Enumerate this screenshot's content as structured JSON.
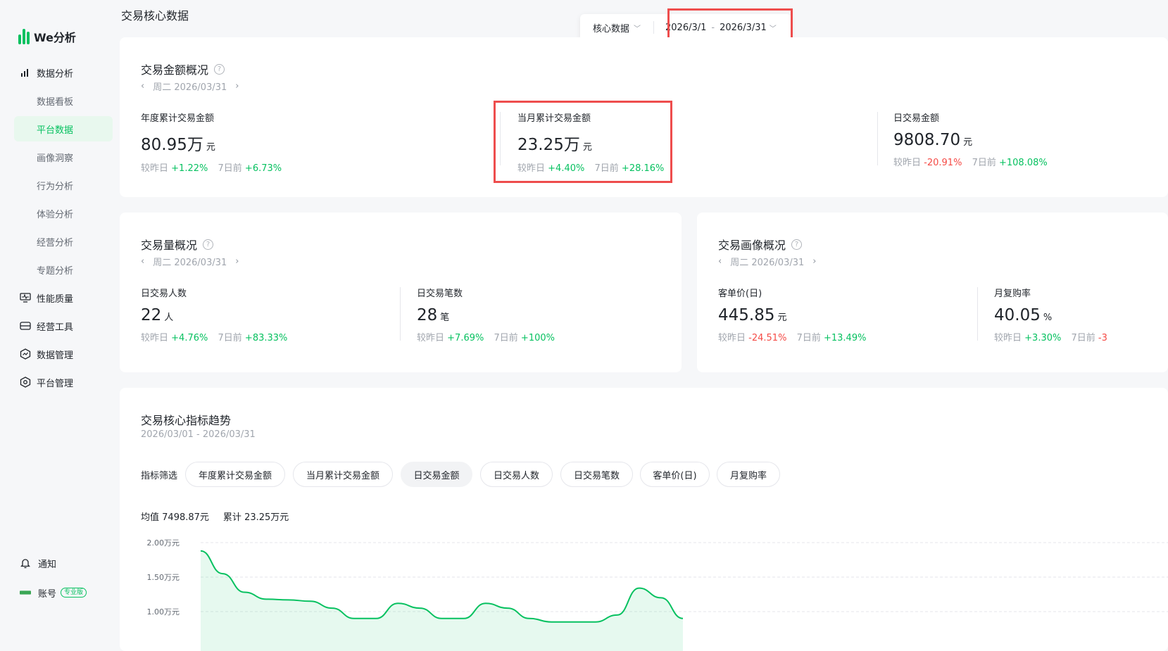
{
  "app": {
    "name": "We分析"
  },
  "sidebar": {
    "groups": [
      {
        "label": "数据分析",
        "icon": "bar-chart-icon"
      }
    ],
    "sub_items": [
      "数据看板",
      "平台数据",
      "画像洞察",
      "行为分析",
      "体验分析",
      "经营分析",
      "专题分析"
    ],
    "active_sub": "平台数据",
    "groups2": [
      {
        "label": "性能质量",
        "icon": "monitor-icon"
      },
      {
        "label": "经营工具",
        "icon": "wallet-icon"
      },
      {
        "label": "数据管理",
        "icon": "data-manage-icon"
      },
      {
        "label": "平台管理",
        "icon": "settings-icon"
      }
    ],
    "bottom": {
      "notify": "通知",
      "account": "账号",
      "pro_badge": "专业版"
    }
  },
  "header": {
    "title": "交易核心数据",
    "filter_type": "核心数据",
    "date_start": "2026/3/1",
    "date_sep": "-",
    "date_end": "2026/3/31"
  },
  "amount_card": {
    "title": "交易金额概况",
    "date": "周二 2026/03/31",
    "metrics": [
      {
        "label": "年度累计交易金额",
        "value": "80.95万",
        "unit": "元",
        "cmp1_label": "较昨日",
        "cmp1": "+1.22%",
        "cmp1_dir": "up",
        "cmp2_label": "7日前",
        "cmp2": "+6.73%",
        "cmp2_dir": "up"
      },
      {
        "label": "当月累计交易金额",
        "value": "23.25万",
        "unit": "元",
        "cmp1_label": "较昨日",
        "cmp1": "+4.40%",
        "cmp1_dir": "up",
        "cmp2_label": "7日前",
        "cmp2": "+28.16%",
        "cmp2_dir": "up"
      },
      {
        "label": "日交易金额",
        "value": "9808.70",
        "unit": "元",
        "cmp1_label": "较昨日",
        "cmp1": "-20.91%",
        "cmp1_dir": "down",
        "cmp2_label": "7日前",
        "cmp2": "+108.08%",
        "cmp2_dir": "up"
      }
    ]
  },
  "volume_card": {
    "title": "交易量概况",
    "date": "周二 2026/03/31",
    "metrics": [
      {
        "label": "日交易人数",
        "value": "22",
        "unit": "人",
        "cmp1_label": "较昨日",
        "cmp1": "+4.76%",
        "cmp1_dir": "up",
        "cmp2_label": "7日前",
        "cmp2": "+83.33%",
        "cmp2_dir": "up"
      },
      {
        "label": "日交易笔数",
        "value": "28",
        "unit": "笔",
        "cmp1_label": "较昨日",
        "cmp1": "+7.69%",
        "cmp1_dir": "up",
        "cmp2_label": "7日前",
        "cmp2": "+100%",
        "cmp2_dir": "up"
      }
    ]
  },
  "profile_card": {
    "title": "交易画像概况",
    "date": "周二 2026/03/31",
    "metrics": [
      {
        "label": "客单价(日)",
        "value": "445.85",
        "unit": "元",
        "cmp1_label": "较昨日",
        "cmp1": "-24.51%",
        "cmp1_dir": "down",
        "cmp2_label": "7日前",
        "cmp2": "+13.49%",
        "cmp2_dir": "up"
      },
      {
        "label": "月复购率",
        "value": "40.05",
        "unit": "%",
        "cmp1_label": "较昨日",
        "cmp1": "+3.30%",
        "cmp1_dir": "up",
        "cmp2_label": "7日前",
        "cmp2": "-3",
        "cmp2_dir": "down"
      }
    ]
  },
  "trend": {
    "title": "交易核心指标趋势",
    "range": "2026/03/01 - 2026/03/31",
    "filter_label": "指标筛选",
    "chips": [
      "年度累计交易金额",
      "当月累计交易金额",
      "日交易金额",
      "日交易人数",
      "日交易笔数",
      "客单价(日)",
      "月复购率"
    ],
    "active_chip": "日交易金额",
    "avg_label": "均值",
    "avg_value": "7498.87元",
    "sum_label": "累计",
    "sum_value": "23.25万元"
  },
  "chart_data": {
    "type": "area",
    "title": "",
    "xlabel": "",
    "ylabel": "",
    "y_ticks": [
      "2.00万元",
      "1.50万元",
      "1.00万元"
    ],
    "ylim": [
      1.0,
      2.0
    ],
    "color": "#07c160",
    "series": [
      {
        "x": [
          1,
          2,
          3,
          4,
          5,
          6,
          7,
          8,
          9,
          10,
          11,
          12,
          13,
          14,
          15,
          16,
          17,
          18,
          19,
          20,
          21,
          22,
          23
        ],
        "values": [
          1.88,
          1.55,
          1.28,
          1.18,
          1.17,
          1.15,
          1.05,
          0.9,
          0.9,
          1.12,
          1.05,
          0.9,
          0.9,
          1.12,
          1.05,
          0.9,
          0.85,
          0.85,
          0.85,
          0.95,
          1.34,
          1.2,
          0.9
        ]
      }
    ]
  },
  "colors": {
    "accent": "#07c160",
    "down": "#f54a45",
    "highlight": "#ee4d4d"
  }
}
